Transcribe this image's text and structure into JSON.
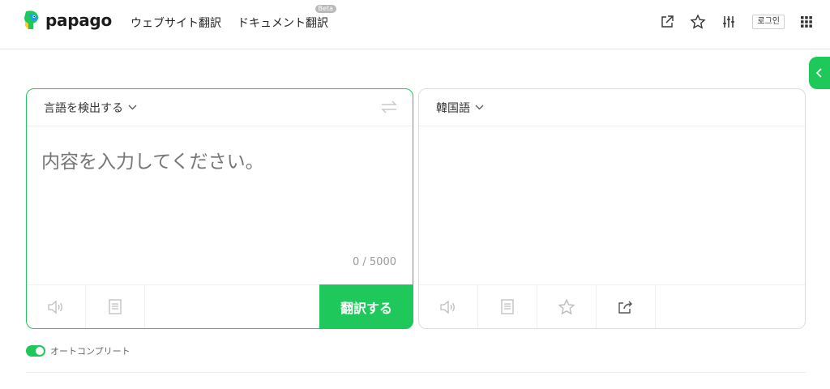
{
  "brand": {
    "name": "papago",
    "accent": "#1ec85b"
  },
  "nav": {
    "web_translate": "ウェブサイト翻訳",
    "doc_translate": "ドキュメント翻訳",
    "beta_badge": "Beta"
  },
  "header_tools": {
    "login": "로그인",
    "icons": [
      "external-link-icon",
      "star-icon",
      "sliders-icon",
      "grid-apps-icon"
    ]
  },
  "source": {
    "language": "言語を検出する",
    "placeholder": "内容を入力してください。",
    "counter": "0 / 5000",
    "translate_button": "翻訳する"
  },
  "target": {
    "language": "韓国語"
  },
  "autocomplete": {
    "label": "オートコンプリート",
    "enabled": true
  }
}
